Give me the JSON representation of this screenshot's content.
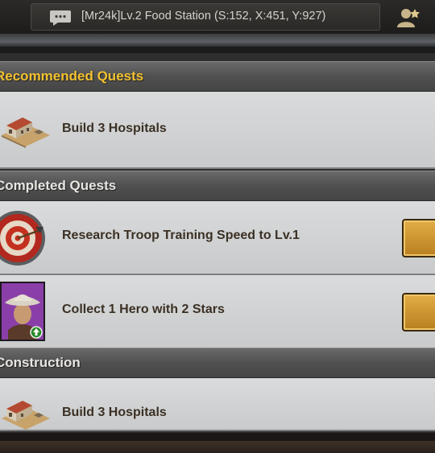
{
  "chat": {
    "message": "[Mr24k]Lv.2 Food Station (S:152, X:451, Y:927)"
  },
  "sections": {
    "recommended": {
      "title": "Recommended Quests",
      "quest_label": "Build 3 Hospitals"
    },
    "completed": {
      "title": "Completed Quests",
      "quests": [
        {
          "label": "Research Troop Training Speed  to Lv.1",
          "icon": "target-arrow-icon"
        },
        {
          "label": "Collect 1 Hero with 2 Stars",
          "icon": "hero-portrait-icon"
        }
      ]
    },
    "construction": {
      "title": "Construction",
      "quest_label": "Build 3 Hospitals"
    }
  },
  "colors": {
    "section_title_highlight": "#f2c230",
    "row_bg": "#d5d7d8",
    "quest_text": "#3b3024",
    "go_button": "#d19a38"
  }
}
